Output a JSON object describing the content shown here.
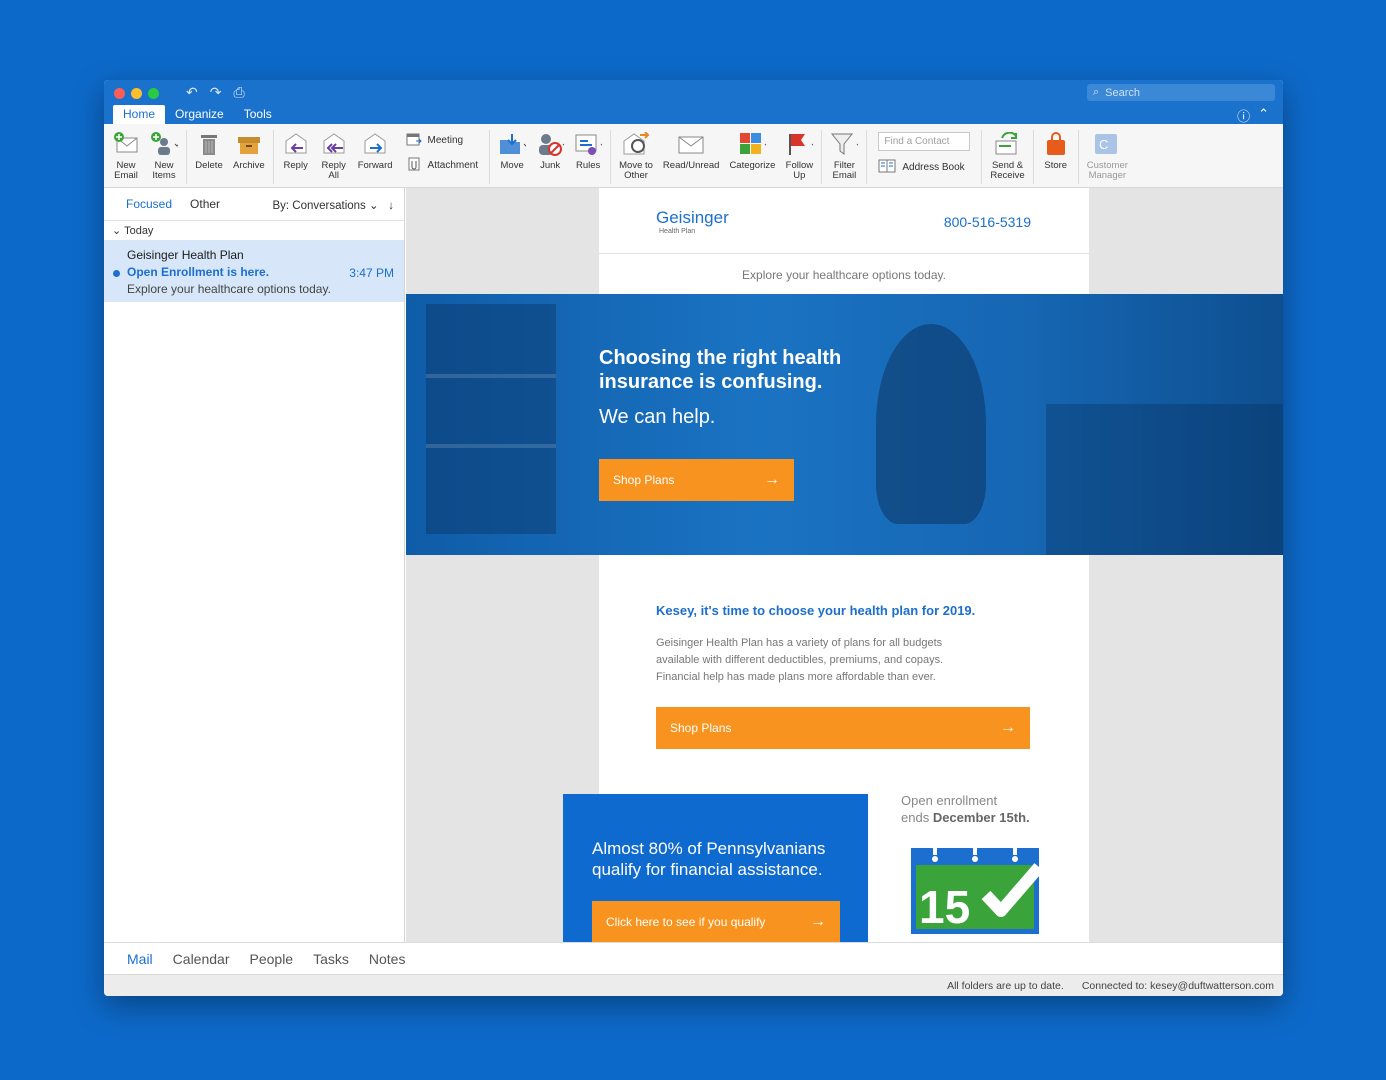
{
  "window": {
    "search_placeholder": "Search",
    "tabs": [
      "Home",
      "Organize",
      "Tools"
    ]
  },
  "ribbon": {
    "new_email": "New\nEmail",
    "new_items": "New\nItems",
    "delete": "Delete",
    "archive": "Archive",
    "reply": "Reply",
    "reply_all": "Reply\nAll",
    "forward": "Forward",
    "meeting": "Meeting",
    "attachment": "Attachment",
    "move": "Move",
    "junk": "Junk",
    "rules": "Rules",
    "move_to_other": "Move to\nOther",
    "read_unread": "Read/Unread",
    "categorize": "Categorize",
    "follow_up": "Follow\nUp",
    "filter_email": "Filter\nEmail",
    "find_contact_placeholder": "Find a Contact",
    "address_book": "Address Book",
    "send_receive": "Send &\nReceive",
    "store": "Store",
    "customer_manager": "Customer\nManager"
  },
  "list": {
    "focused": "Focused",
    "other": "Other",
    "sort": "By: Conversations",
    "group": "Today",
    "message": {
      "from": "Geisinger Health Plan",
      "subject": "Open Enrollment is here.",
      "preview": "Explore your healthcare options today.",
      "time": "3:47 PM"
    }
  },
  "email": {
    "logo": "Geisinger",
    "logo_sub": "Health Plan",
    "phone": "800-516-5319",
    "tagline": "Explore your healthcare options today.",
    "hero_title": "Choosing the right health insurance is confusing.",
    "hero_help": "We can help.",
    "shop_plans": "Shop Plans",
    "greeting": "Kesey, it's time to choose your health plan for 2019.",
    "body": "Geisinger Health Plan has a variety of plans for all budgets available with different deductibles, premiums, and copays. Financial help has made plans more affordable than ever.",
    "promo": "Almost 80% of Pennsylvanians qualify for financial assistance.",
    "promo_button": "Click here to see if you qualify",
    "enroll_line1": "Open enrollment",
    "enroll_line2_prefix": "ends ",
    "enroll_date": "December 15th.",
    "calendar_day": "15"
  },
  "nav": [
    "Mail",
    "Calendar",
    "People",
    "Tasks",
    "Notes"
  ],
  "status": {
    "sync": "All folders are up to date.",
    "connected": "Connected to: kesey@duftwatterson.com"
  },
  "colors": {
    "accent": "#1c6fcf",
    "orange": "#f7931e",
    "background": "#0d69c9"
  }
}
